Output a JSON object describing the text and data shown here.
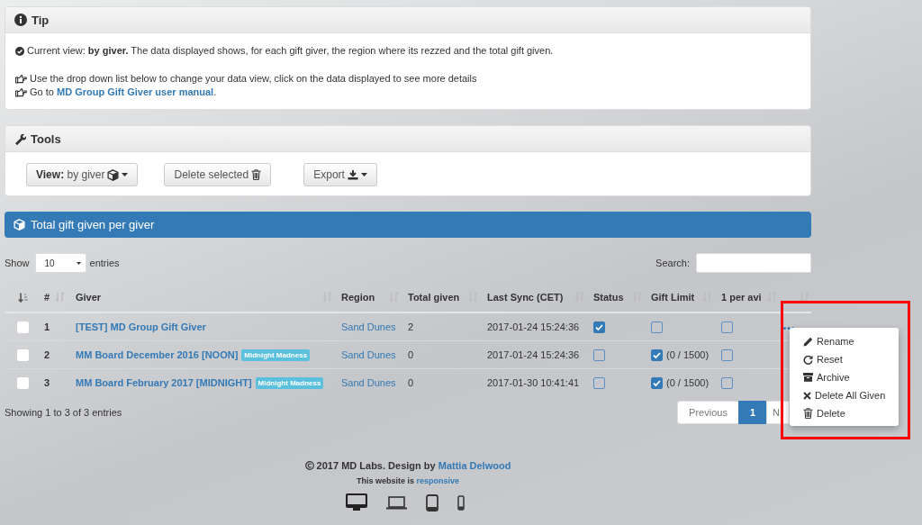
{
  "tip": {
    "title": "Tip",
    "lines": [
      {
        "kind": "check",
        "text": "Current view: **by giver.** The data displayed shows, for each gift giver, the region where its rezzed and the total gift given."
      },
      {
        "kind": "hand",
        "text": "Use the drop down list below to change your data view, click on the data displayed to see more details"
      },
      {
        "kind": "hand",
        "text": "Go to ",
        "link": "MD Group Gift Giver user manual",
        "suffix": "."
      }
    ]
  },
  "tools": {
    "title": "Tools",
    "buttons": [
      {
        "kind": "view",
        "label": "**View:** by giver"
      },
      {
        "kind": "delete",
        "label": "Delete selected"
      },
      {
        "kind": "export",
        "label": "Export"
      }
    ]
  },
  "section_bar": {
    "title": "Total gift given per giver"
  },
  "length_menu": {
    "before": "Show",
    "value": "10",
    "after": "entries"
  },
  "search": {
    "label": "Search:"
  },
  "table": {
    "columns": [
      "#",
      "Giver",
      "Region",
      "Total given",
      "Last Sync (CET)",
      "Status",
      "Gift Limit",
      "1 per avi"
    ],
    "rows": [
      {
        "selected": false,
        "number": "1",
        "giver": "[TEST] MD Group Gift Giver",
        "region": "Sand Dunes",
        "total": "2",
        "last_sync": "2017-01-24 15:24:36",
        "status": true,
        "gift_limit": false,
        "per_avi": false
      },
      {
        "selected": false,
        "number": "2",
        "giver": "MM Board December 2016 [NOON]",
        "tag": "Midnight Madness",
        "region": "Sand Dunes",
        "total": "0",
        "last_sync": "2017-01-24 15:24:36",
        "status": false,
        "gift_limit": true,
        "gift_limit_text": "(0 / 1500)",
        "per_avi": false
      },
      {
        "selected": false,
        "number": "3",
        "giver": "MM Board February 2017 [MIDNIGHT]",
        "tag": "Midnight Madness",
        "region": "Sand Dunes",
        "total": "0",
        "last_sync": "2017-01-30 10:41:41",
        "status": false,
        "gift_limit": true,
        "gift_limit_text": "(0 / 1500)",
        "per_avi": false
      }
    ]
  },
  "info": "Showing 1 to 3 of 3 entries",
  "pagination": [
    {
      "label": "Previous",
      "selected": false
    },
    {
      "label": "1",
      "selected": true
    },
    {
      "label": "N",
      "selected": false
    }
  ],
  "row_menu": {
    "items": [
      {
        "kind": "rename",
        "label": "Rename"
      },
      {
        "kind": "reset",
        "label": "Reset"
      },
      {
        "kind": "archive",
        "label": "Archive"
      },
      {
        "kind": "delete_all",
        "label": "Delete All Given"
      },
      {
        "kind": "delete",
        "label": "Delete"
      }
    ]
  },
  "footer": {
    "copyright": "2017 MD Labs. Design by ",
    "author": "Mattia Delwood",
    "responsive_prefix": "This website is ",
    "responsive_link": "responsive"
  }
}
